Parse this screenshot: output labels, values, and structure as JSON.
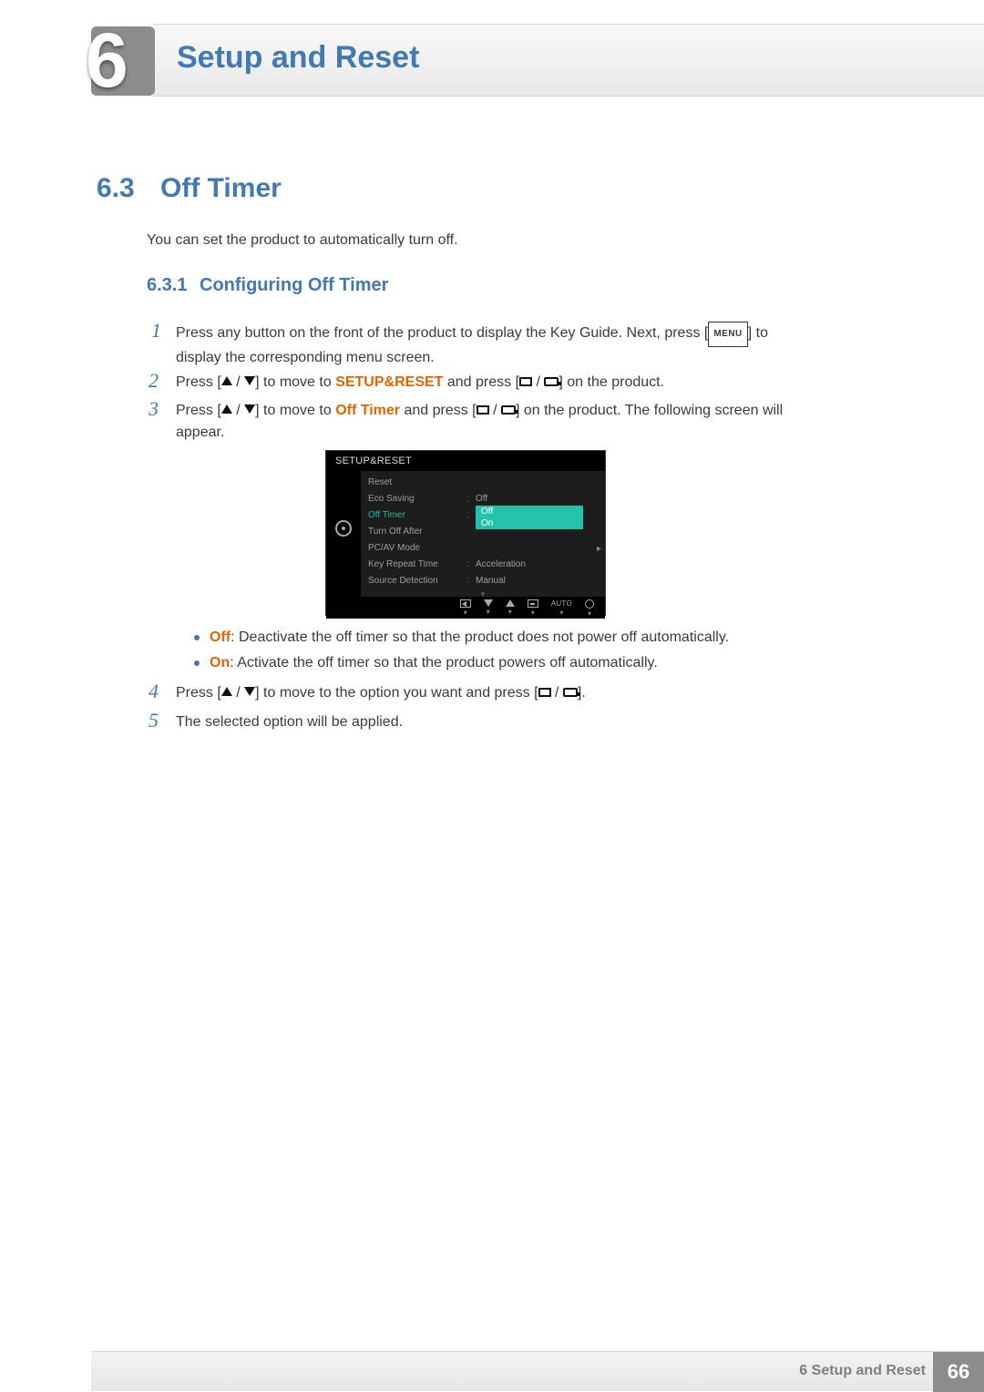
{
  "chapter": {
    "number": "6",
    "title": "Setup and Reset"
  },
  "section": {
    "number": "6.3",
    "title": "Off Timer"
  },
  "intro": "You can set the product to automatically turn off.",
  "subsection": {
    "number": "6.3.1",
    "title": "Configuring Off Timer"
  },
  "steps": {
    "s1a": "Press any button on the front of the product to display the Key Guide. Next, press [",
    "s1b": "] to display the corresponding menu screen.",
    "menu_badge": "MENU",
    "s2a": "Press [",
    "s2b": "] to move to ",
    "s2c": "SETUP&RESET",
    "s2d": " and press [",
    "s2e": "] on the product.",
    "s3a": "Press [",
    "s3b": "] to move to ",
    "s3c": "Off Timer",
    "s3d": " and press [",
    "s3e": "] on the product. The following screen will appear.",
    "s4a": "Press [",
    "s4b": "] to move to the option you want and press [",
    "s4c": "].",
    "s5": "The selected option will be applied."
  },
  "bullets": {
    "off_label": "Off",
    "off_text": ": Deactivate the off timer so that the product does not power off automatically.",
    "on_label": "On",
    "on_text": ": Activate the off timer so that the product powers off automatically."
  },
  "osd": {
    "title": "SETUP&RESET",
    "items": [
      {
        "label": "Reset",
        "value": ""
      },
      {
        "label": "Eco Saving",
        "value": "Off"
      },
      {
        "label": "Off Timer",
        "value": "",
        "highlight": true
      },
      {
        "label": "Turn Off After",
        "value": ""
      },
      {
        "label": "PC/AV Mode",
        "value": ""
      },
      {
        "label": "Key Repeat Time",
        "value": "Acceleration"
      },
      {
        "label": "Source Detection",
        "value": "Manual"
      }
    ],
    "dropdown": [
      "Off",
      "On"
    ],
    "footer_auto": "AUTO"
  },
  "footer": {
    "label": "6 Setup and Reset",
    "page": "66"
  }
}
